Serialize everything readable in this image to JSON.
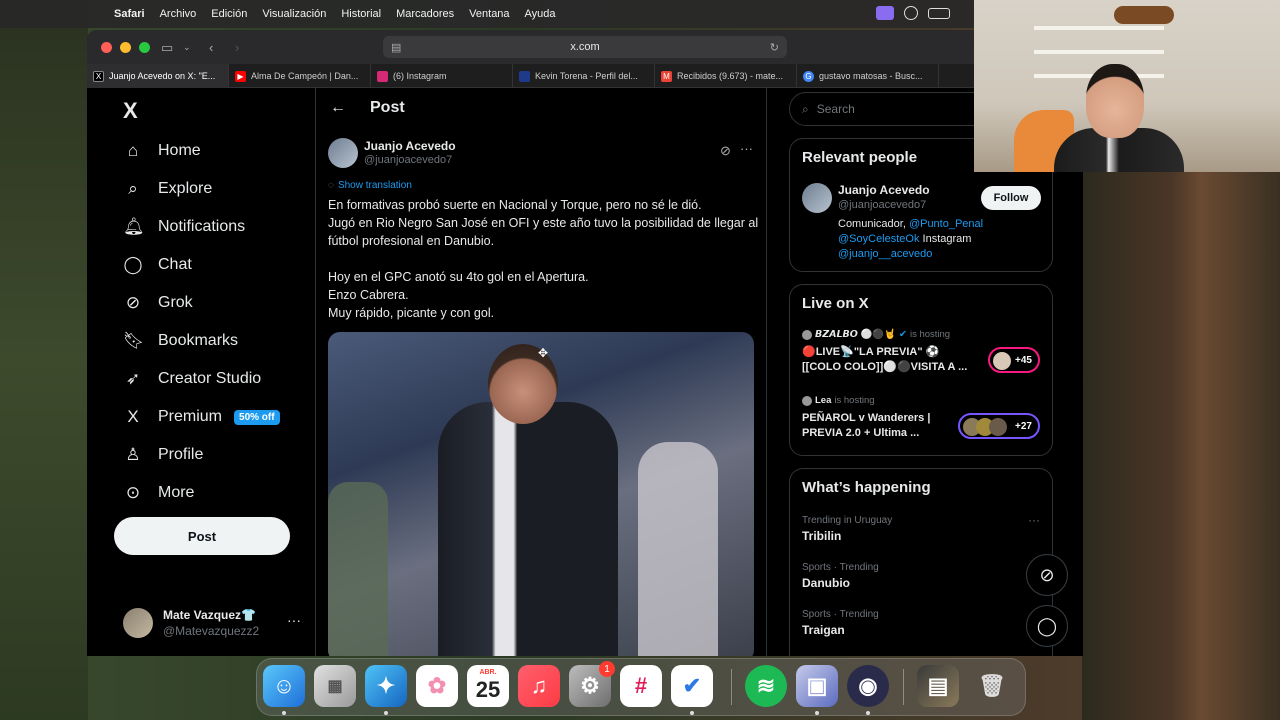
{
  "menubar": {
    "apple": "",
    "items": [
      "Safari",
      "Archivo",
      "Edición",
      "Visualización",
      "Historial",
      "Marcadores",
      "Ventana",
      "Ayuda"
    ]
  },
  "browser": {
    "url": "x.com",
    "tabs": [
      {
        "label": "Juanjo Acevedo on X: \"E...",
        "icon": "x-icon",
        "color": "#000000"
      },
      {
        "label": "Alma De Campeón | Dan...",
        "icon": "youtube-icon",
        "color": "#ff0000"
      },
      {
        "label": "(6) Instagram",
        "icon": "instagram-icon",
        "color": "#d62976"
      },
      {
        "label": "Kevin Torena - Perfil del...",
        "icon": "site-icon",
        "color": "#1e3a8a"
      },
      {
        "label": "Recibidos (9.673) - mate...",
        "icon": "gmail-icon",
        "color": "#ea4335"
      },
      {
        "label": "gustavo matosas - Busc...",
        "icon": "google-icon",
        "color": "#4285f4"
      }
    ]
  },
  "nav": {
    "logo": "X",
    "items": [
      {
        "label": "Home",
        "icon": "home-icon"
      },
      {
        "label": "Explore",
        "icon": "search-icon"
      },
      {
        "label": "Notifications",
        "icon": "bell-icon"
      },
      {
        "label": "Chat",
        "icon": "chat-icon"
      },
      {
        "label": "Grok",
        "icon": "grok-icon"
      },
      {
        "label": "Bookmarks",
        "icon": "bookmark-icon"
      },
      {
        "label": "Creator Studio",
        "icon": "rocket-icon"
      },
      {
        "label": "Premium",
        "icon": "x-premium-icon",
        "badge": "50% off"
      },
      {
        "label": "Profile",
        "icon": "person-icon"
      },
      {
        "label": "More",
        "icon": "more-circle-icon"
      }
    ],
    "post_button": "Post",
    "account": {
      "name": "Mate Vazquez👕",
      "handle": "@Matevazquezz2"
    }
  },
  "main": {
    "header_title": "Post",
    "author": {
      "name": "Juanjo Acevedo",
      "handle": "@juanjoacevedo7"
    },
    "show_translation": "Show translation",
    "text_lines": [
      "En formativas probó suerte en Nacional y Torque, pero no sé le dió.",
      "Jugó en Rio Negro San José en OFI y este año tuvo la posibilidad de llegar al fútbol profesional en Danubio.",
      "",
      "Hoy en el GPC anotó su 4to gol en el Apertura.",
      "Enzo Cabrera.",
      "Muy rápido, picante y con gol."
    ]
  },
  "sidebar": {
    "search_placeholder": "Search",
    "relevant": {
      "title": "Relevant people",
      "name": "Juanjo Acevedo",
      "handle": "@juanjoacevedo7",
      "follow": "Follow",
      "bio_prefix": "Comunicador, ",
      "bio_link1": "@Punto_Penal",
      "bio_link2": "@SoyCelesteOk",
      "bio_mid": " Instagram",
      "bio_link3": "@juanjo__acevedo"
    },
    "live": {
      "title": "Live on X",
      "items": [
        {
          "host": "𝘽𝙕𝘼𝙇𝘽𝙊 ⚪⚫🤘",
          "hosting": "is hosting",
          "title": "🔴LIVE📡\"LA PREVIA\" ⚽ [[COLO COLO]]⚪⚫VISITA A ...",
          "count": "+45",
          "pill_color": "#f91880"
        },
        {
          "host": "Lea",
          "hosting": "is hosting",
          "title": "PEÑAROL v Wanderers | PREVIA 2.0 + Ultima ...",
          "count": "+27",
          "pill_color": "#7856ff"
        }
      ]
    },
    "happening": {
      "title": "What’s happening",
      "trends": [
        {
          "category": "Trending in Uruguay",
          "topic": "Tribilin"
        },
        {
          "category": "Sports · Trending",
          "topic": "Danubio"
        },
        {
          "category": "Sports · Trending",
          "topic": "Traigan"
        }
      ]
    }
  },
  "dock": {
    "calendar_month": "ABR.",
    "calendar_day": "25",
    "settings_badge": "1"
  }
}
